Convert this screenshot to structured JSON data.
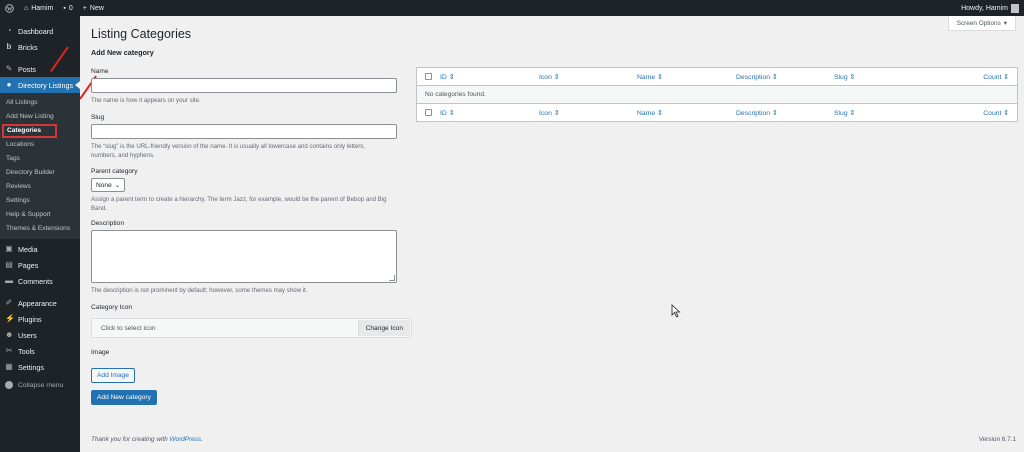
{
  "adminbar": {
    "site_name": "Hamim",
    "comments_count": "0",
    "new_label": "New",
    "howdy": "Howdy, Hamim"
  },
  "sidebar": {
    "items_top": [
      {
        "label": "Dashboard",
        "icon": "dashboard-icon"
      },
      {
        "label": "Bricks",
        "icon": "bricks-icon"
      }
    ],
    "posts": {
      "label": "Posts",
      "icon": "pin-icon"
    },
    "current": {
      "label": "Directory Listings",
      "icon": "listings-icon"
    },
    "submenu": [
      {
        "label": "All Listings"
      },
      {
        "label": "Add New Listing"
      },
      {
        "label": "Categories",
        "active": true
      },
      {
        "label": "Locations"
      },
      {
        "label": "Tags"
      },
      {
        "label": "Directory Builder"
      },
      {
        "label": "Reviews"
      },
      {
        "label": "Settings"
      },
      {
        "label": "Help & Support"
      },
      {
        "label": "Themes & Extensions"
      }
    ],
    "items_mid": [
      {
        "label": "Media",
        "icon": "media-icon"
      },
      {
        "label": "Pages",
        "icon": "pages-icon"
      },
      {
        "label": "Comments",
        "icon": "comments-icon"
      }
    ],
    "items_bottom": [
      {
        "label": "Appearance",
        "icon": "appearance-icon"
      },
      {
        "label": "Plugins",
        "icon": "plugins-icon"
      },
      {
        "label": "Users",
        "icon": "users-icon"
      },
      {
        "label": "Tools",
        "icon": "tools-icon"
      },
      {
        "label": "Settings",
        "icon": "settings-icon"
      }
    ],
    "collapse_label": "Collapse menu"
  },
  "screen_options": "Screen Options",
  "page_title": "Listing Categories",
  "form": {
    "heading": "Add New category",
    "name_label": "Name",
    "name_hint": "The name is how it appears on your site.",
    "slug_label": "Slug",
    "slug_hint": "The “slug” is the URL-friendly version of the name. It is usually all lowercase and contains only letters, numbers, and hyphens.",
    "parent_label": "Parent category",
    "parent_value": "None",
    "parent_hint": "Assign a parent term to create a hierarchy. The term Jazz, for example, would be the parent of Bebop and Big Band.",
    "description_label": "Description",
    "description_hint": "The description is not prominent by default; however, some themes may show it.",
    "icon_label": "Category Icon",
    "icon_placeholder": "Click to select icon",
    "change_icon": "Change Icon",
    "image_label": "Image",
    "add_image": "Add Image",
    "submit": "Add New category"
  },
  "table": {
    "columns": [
      "ID",
      "Icon",
      "Name",
      "Description",
      "Slug",
      "Count"
    ],
    "empty_message": "No categories found."
  },
  "footer": {
    "thanks_prefix": "Thank you for creating with",
    "wordpress": "WordPress",
    "version": "Version 6.7.1"
  },
  "colors": {
    "accent": "#2271b1",
    "annotation": "#e0241b",
    "sidebar": "#1d2327"
  }
}
